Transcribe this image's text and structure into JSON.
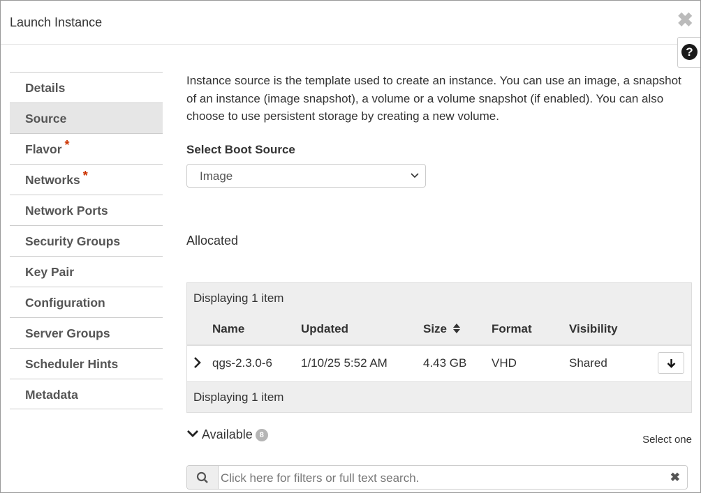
{
  "modal": {
    "title": "Launch Instance",
    "close": "✖",
    "help": "?"
  },
  "nav": {
    "items": [
      {
        "label": "Details",
        "required": false
      },
      {
        "label": "Source",
        "required": false,
        "active": true
      },
      {
        "label": "Flavor",
        "required": true
      },
      {
        "label": "Networks",
        "required": true
      },
      {
        "label": "Network Ports",
        "required": false
      },
      {
        "label": "Security Groups",
        "required": false
      },
      {
        "label": "Key Pair",
        "required": false
      },
      {
        "label": "Configuration",
        "required": false
      },
      {
        "label": "Server Groups",
        "required": false
      },
      {
        "label": "Scheduler Hints",
        "required": false
      },
      {
        "label": "Metadata",
        "required": false
      }
    ],
    "required_mark": "*"
  },
  "source": {
    "intro": "Instance source is the template used to create an instance. You can use an image, a snapshot of an instance (image snapshot), a volume or a volume snapshot (if enabled). You can also choose to use persistent storage by creating a new volume.",
    "boot_label": "Select Boot Source",
    "boot_value": "Image",
    "allocated_label": "Allocated",
    "table": {
      "caption": "Displaying 1 item",
      "footer": "Displaying 1 item",
      "headers": {
        "name": "Name",
        "updated": "Updated",
        "size": "Size",
        "format": "Format",
        "visibility": "Visibility"
      },
      "rows": [
        {
          "name": "qgs-2.3.0-6",
          "updated": "1/10/25 5:52 AM",
          "size": "4.43 GB",
          "format": "VHD",
          "visibility": "Shared"
        }
      ]
    },
    "available_label": "Available",
    "available_count": "8",
    "select_one": "Select one",
    "search_placeholder": "Click here for filters or full text search.",
    "search_clear": "✖"
  },
  "colors": {
    "required": "#cc3300",
    "active_nav_bg": "#e6e6e6",
    "table_bg": "#eeeeee",
    "badge_bg": "#b5b5b5"
  },
  "icons": {
    "close": "close-icon",
    "help": "question-circle-icon",
    "chevron_down": "chevron-down-icon",
    "chevron_right": "chevron-right-icon",
    "sort": "sort-icon",
    "download": "arrow-down-icon",
    "search": "search-icon",
    "clear": "times-icon"
  }
}
